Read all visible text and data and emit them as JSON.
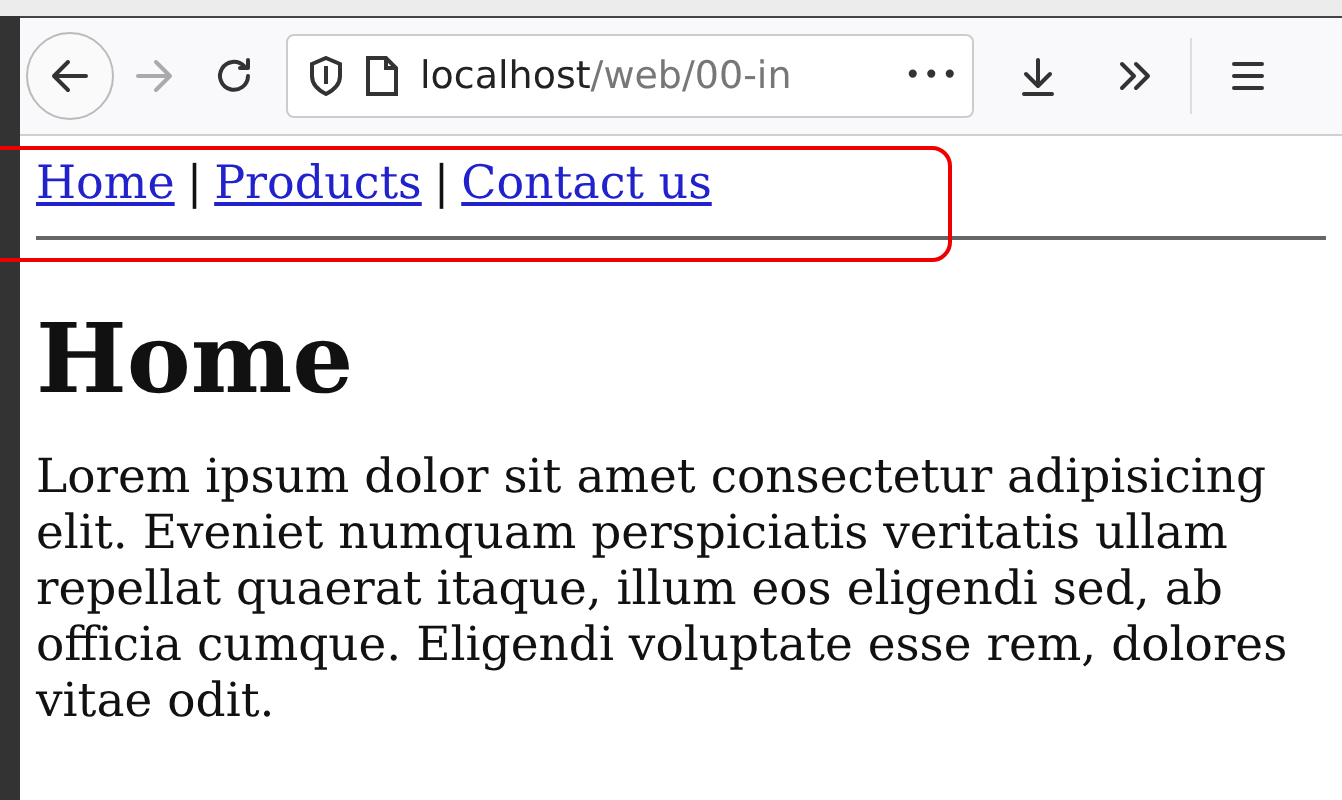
{
  "toolbar": {
    "url_host": "localhost",
    "url_path": "/web/00-in",
    "more": "•••"
  },
  "nav": {
    "items": [
      {
        "label": "Home"
      },
      {
        "label": "Products"
      },
      {
        "label": "Contact us"
      }
    ],
    "separator": "|"
  },
  "heading": "Home",
  "paragraph": "Lorem ipsum dolor sit amet consectetur adipisicing elit. Eveniet numquam perspiciatis veritatis ullam repellat quaerat itaque, illum eos eligendi sed, ab officia cumque. Eligendi voluptate esse rem, dolores vitae odit."
}
